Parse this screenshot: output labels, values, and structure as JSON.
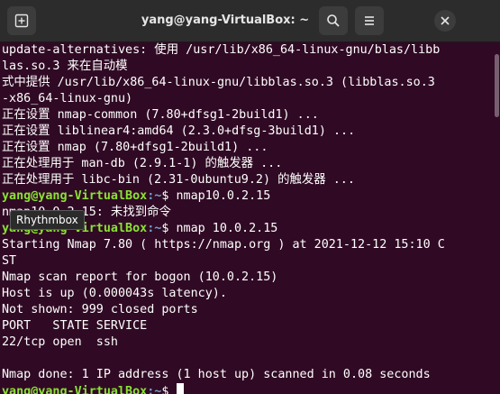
{
  "window": {
    "title": "yang@yang-VirtualBox: ~"
  },
  "tooltip": {
    "text": "Rhythmbox"
  },
  "terminal": {
    "lines": [
      {
        "text": "update-alternatives: 使用 /usr/lib/x86_64-linux-gnu/blas/libb"
      },
      {
        "text": "las.so.3 来在自动模"
      },
      {
        "text": "式中提供 /usr/lib/x86_64-linux-gnu/libblas.so.3 (libblas.so.3"
      },
      {
        "text": "-x86_64-linux-gnu)"
      },
      {
        "text": "正在设置 nmap-common (7.80+dfsg1-2build1) ..."
      },
      {
        "text": "正在设置 liblinear4:amd64 (2.3.0+dfsg-3build1) ..."
      },
      {
        "text": "正在设置 nmap (7.80+dfsg1-2build1) ..."
      },
      {
        "text": "正在处理用于 man-db (2.9.1-1) 的触发器 ..."
      },
      {
        "text": "正在处理用于 libc-bin (2.31-0ubuntu9.2) 的触发器 ..."
      },
      {
        "prompt_user": "yang@yang-VirtualBox",
        "prompt_path": ":~",
        "prompt_symbol": "$ ",
        "command": "nmap10.0.2.15"
      },
      {
        "text": "nmap10.0.2.15: 未找到命令"
      },
      {
        "prompt_user": "yang@yang-VirtualBox",
        "prompt_path": ":~",
        "prompt_symbol": "$ ",
        "command": "nmap 10.0.2.15"
      },
      {
        "text": "Starting Nmap 7.80 ( https://nmap.org ) at 2021-12-12 15:10 C"
      },
      {
        "text": "ST"
      },
      {
        "text": "Nmap scan report for bogon (10.0.2.15)"
      },
      {
        "text": "Host is up (0.000043s latency)."
      },
      {
        "text": "Not shown: 999 closed ports"
      },
      {
        "text": "PORT   STATE SERVICE"
      },
      {
        "text": "22/tcp open  ssh"
      },
      {
        "text": ""
      },
      {
        "text": "Nmap done: 1 IP address (1 host up) scanned in 0.08 seconds"
      },
      {
        "prompt_user": "yang@yang-VirtualBox",
        "prompt_path": ":~",
        "prompt_symbol": "$ ",
        "command": "",
        "cursor": true
      }
    ]
  },
  "icons": {
    "new_tab": "new-tab-icon",
    "search": "search-icon",
    "menu": "hamburger-menu-icon",
    "close": "close-icon"
  },
  "colors": {
    "background": "#300a24",
    "prompt_user": "#8ae234",
    "prompt_path": "#729fcf",
    "text": "#ffffff",
    "titlebar": "#2c2c2c"
  }
}
